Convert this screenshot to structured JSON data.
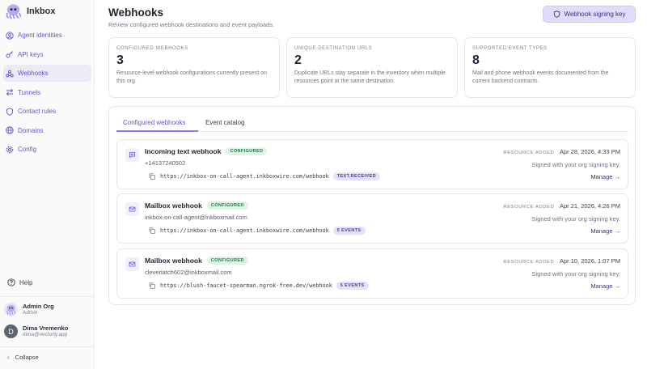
{
  "app": {
    "name": "Inkbox"
  },
  "sidebar": {
    "items": [
      {
        "label": "Agent identities",
        "icon": "user-circle-icon",
        "active": false
      },
      {
        "label": "API keys",
        "icon": "key-icon",
        "active": false
      },
      {
        "label": "Webhooks",
        "icon": "webhook-icon",
        "active": true
      },
      {
        "label": "Tunnels",
        "icon": "tunnel-arrows-icon",
        "active": false
      },
      {
        "label": "Contact rules",
        "icon": "shield-icon",
        "active": false
      },
      {
        "label": "Domains",
        "icon": "globe-icon",
        "active": false
      },
      {
        "label": "Config",
        "icon": "gear-icon",
        "active": false
      }
    ],
    "help_label": "Help",
    "org": {
      "name": "Admin Org",
      "role": "Admin"
    },
    "user": {
      "initial": "D",
      "name": "Dima Vremenko",
      "email": "dima@vectorly.app"
    },
    "collapse_label": "Collapse"
  },
  "header": {
    "title": "Webhooks",
    "subtitle": "Review configured webhook destinations and event payloads.",
    "signing_key_button": "Webhook signing key"
  },
  "stats": [
    {
      "label": "CONFIGURED WEBHOOKS",
      "value": "3",
      "desc": "Resource-level webhook configurations currently present on this org."
    },
    {
      "label": "UNIQUE DESTINATION URLS",
      "value": "2",
      "desc": "Duplicate URLs stay separate in the inventory when multiple resources point at the same destination."
    },
    {
      "label": "SUPPORTED EVENT TYPES",
      "value": "8",
      "desc": "Mail and phone webhook events documented from the current backend contracts."
    }
  ],
  "tabs": [
    {
      "label": "Configured webhooks",
      "active": true
    },
    {
      "label": "Event catalog",
      "active": false
    }
  ],
  "webhooks": [
    {
      "icon": "message-icon",
      "title": "Incoming text webhook",
      "status": "CONFIGURED",
      "resource": "+14137240502",
      "url": "https://inkbox-on-call-agent.inkboxwire.com/webhook",
      "events": "TEXT.RECEIVED",
      "added_label": "RESOURCE ADDED",
      "added": "Apr 28, 2026, 4:33 PM",
      "signed": "Signed with your org signing key.",
      "manage": "Manage →"
    },
    {
      "icon": "mail-icon",
      "title": "Mailbox webhook",
      "status": "CONFIGURED",
      "resource": "inkbox-on-call-agent@inkboxmail.com",
      "url": "https://inkbox-on-call-agent.inkboxwire.com/webhook",
      "events": "5 EVENTS",
      "added_label": "RESOURCE ADDED",
      "added": "Apr 21, 2026, 4:26 PM",
      "signed": "Signed with your org signing key.",
      "manage": "Manage →"
    },
    {
      "icon": "mail-icon",
      "title": "Mailbox webhook",
      "status": "CONFIGURED",
      "resource": "cleverlatch602@inkboxmail.com",
      "url": "https://blush-faucet-spearman.ngrok-free.dev/webhook",
      "events": "5 EVENTS",
      "added_label": "RESOURCE ADDED",
      "added": "Apr 10, 2026, 1:07 PM",
      "signed": "Signed with your org signing key.",
      "manage": "Manage →"
    }
  ],
  "colors": {
    "accent": "#6a4fd8",
    "badge_green": "#207a45",
    "button_bg": "#e3dbfb"
  }
}
